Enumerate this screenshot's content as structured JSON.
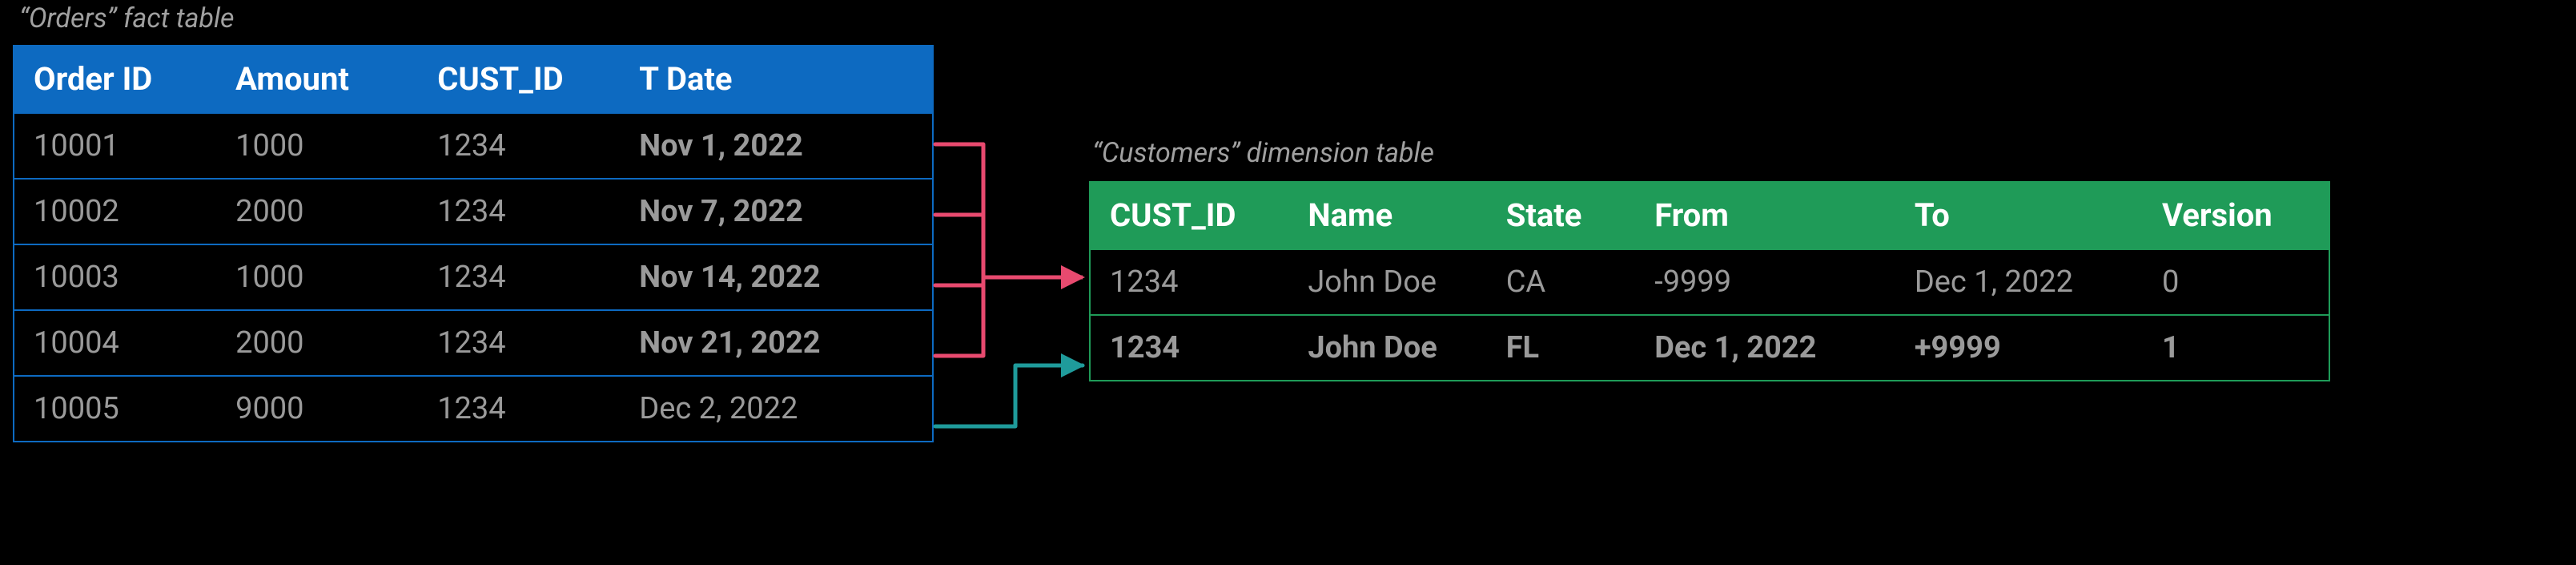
{
  "orders": {
    "caption": "“Orders” fact table",
    "headers": [
      "Order ID",
      "Amount",
      "CUST_ID",
      "T Date"
    ],
    "rows": [
      {
        "cells": [
          "10001",
          "1000",
          "1234",
          "Nov 1, 2022"
        ],
        "bold_last": true
      },
      {
        "cells": [
          "10002",
          "2000",
          "1234",
          "Nov 7, 2022"
        ],
        "bold_last": true
      },
      {
        "cells": [
          "10003",
          "1000",
          "1234",
          "Nov 14, 2022"
        ],
        "bold_last": true
      },
      {
        "cells": [
          "10004",
          "2000",
          "1234",
          "Nov 21, 2022"
        ],
        "bold_last": true
      },
      {
        "cells": [
          "10005",
          "9000",
          "1234",
          "Dec 2, 2022"
        ],
        "bold_last": false
      }
    ]
  },
  "customers": {
    "caption": "“Customers” dimension table",
    "headers": [
      "CUST_ID",
      "Name",
      "State",
      "From",
      "To",
      "Version"
    ],
    "rows": [
      {
        "cells": [
          "1234",
          "John Doe",
          "CA",
          "-9999",
          "Dec 1, 2022",
          "0"
        ],
        "bold_row": false
      },
      {
        "cells": [
          "1234",
          "John Doe",
          "FL",
          "Dec 1, 2022",
          "+9999",
          "1"
        ],
        "bold_row": true
      }
    ]
  },
  "colors": {
    "orders_accent": "#0d6ac1",
    "customers_accent": "#1f9b58",
    "arrow_pink": "#e84a6f",
    "arrow_teal": "#1f9b9b"
  }
}
